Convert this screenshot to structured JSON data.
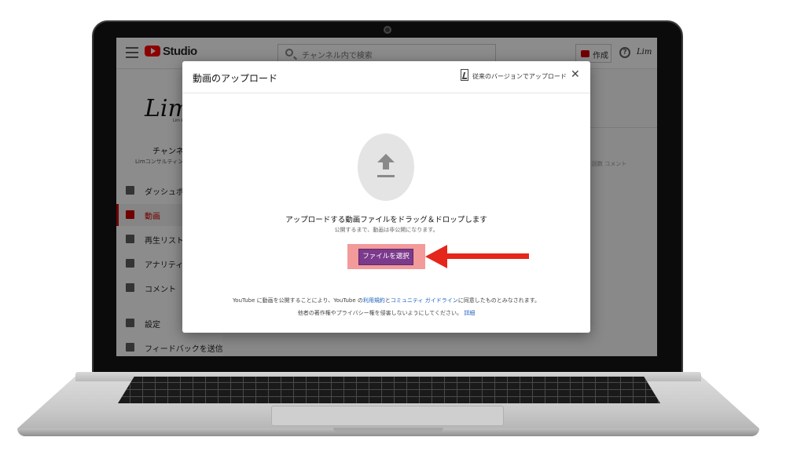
{
  "app": {
    "brand": "Studio",
    "search_placeholder": "チャンネル内で検索",
    "create_label": "作成",
    "help_glyph": "?",
    "avatar_text": "Lim"
  },
  "sidebar": {
    "channel_logo": "Lim",
    "channel_logo_small": "Lim ko",
    "channel_title": "チャンネル",
    "channel_subtitle": "Limコンサルティング",
    "items": [
      {
        "label": "ダッシュボード",
        "icon": "dashboard-icon",
        "active": false
      },
      {
        "label": "動画",
        "icon": "video-icon",
        "active": true
      },
      {
        "label": "再生リスト",
        "icon": "playlist-icon",
        "active": false
      },
      {
        "label": "アナリティクス",
        "icon": "analytics-icon",
        "active": false
      },
      {
        "label": "コメント",
        "icon": "comment-icon",
        "active": false
      },
      {
        "label": "設定",
        "icon": "gear-icon",
        "active": false
      },
      {
        "label": "フィードバックを送信",
        "icon": "feedback-icon",
        "active": false
      }
    ]
  },
  "content": {
    "column_hint": "回数  コメント"
  },
  "dialog": {
    "title": "動画のアップロード",
    "legacy_link": "従来のバージョンでアップロード",
    "close_glyph": "✕",
    "main_text": "アップロードする動画ファイルをドラッグ＆ドロップします",
    "sub_text": "公開するまで、動画は非公開になります。",
    "select_button": "ファイルを選択",
    "terms_prefix": "YouTube に動画を公開することにより、YouTube の",
    "terms_link1": "利用規約",
    "terms_and": "と",
    "terms_link2": "コミュニティ ガイドライン",
    "terms_suffix": "に同意したものとみなされます。",
    "privacy_text": "他者の著作権やプライバシー権を侵害しないようにしてください。",
    "privacy_link": "詳細"
  },
  "colors": {
    "highlight": "#f39a9a",
    "select_button": "#7b3a8c",
    "pointer_arrow": "#e5261a",
    "brand_red": "#ff0000"
  }
}
